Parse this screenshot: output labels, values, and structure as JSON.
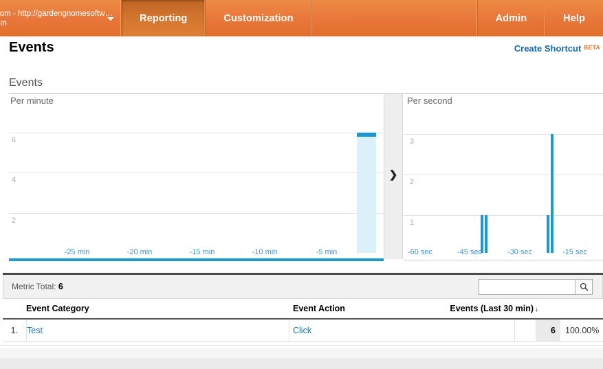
{
  "topbar": {
    "account_line1": "com - http://gardengnomesoftw…",
    "account_line2": "om",
    "tab_reporting": "Reporting",
    "tab_customization": "Customization",
    "tab_admin": "Admin",
    "tab_help": "Help",
    "accent_orange": "#e8763a",
    "active_tab": "Reporting"
  },
  "page": {
    "title": "Events",
    "create_shortcut": "Create Shortcut",
    "beta_badge": "BETA",
    "section_title": "Events"
  },
  "charts": {
    "left_label": "Per minute",
    "right_label": "Per second",
    "collapse_arrow": "❯",
    "bar_color": "#1a9ad4",
    "highlight_color": "#dcf0fa",
    "axis_label_color": "#3f96c9"
  },
  "chart_data": [
    {
      "type": "bar",
      "title": "Per minute",
      "xlabel": "",
      "ylabel": "",
      "ylim": [
        0,
        7
      ],
      "yticks": [
        2,
        4,
        6
      ],
      "grid": true,
      "x_tick_labels": [
        "-25 min",
        "-20 min",
        "-15 min",
        "-10 min",
        "-5 min"
      ],
      "x_tick_positions": [
        -25,
        -20,
        -15,
        -10,
        -5
      ],
      "x_range": [
        -30,
        0
      ],
      "highlighted_bar": {
        "x": -2,
        "value": 6
      },
      "categories": [
        -30,
        -29,
        -28,
        -27,
        -26,
        -25,
        -24,
        -23,
        -22,
        -21,
        -20,
        -19,
        -18,
        -17,
        -16,
        -15,
        -14,
        -13,
        -12,
        -11,
        -10,
        -9,
        -8,
        -7,
        -6,
        -5,
        -4,
        -3,
        -2,
        -1
      ],
      "values": [
        0,
        0,
        0,
        0,
        0,
        0,
        0,
        0,
        0,
        0,
        0,
        0,
        0,
        0,
        0,
        0,
        0,
        0,
        0,
        0,
        0,
        0,
        0,
        0,
        0,
        0,
        0,
        0,
        6,
        0
      ]
    },
    {
      "type": "bar",
      "title": "Per second",
      "xlabel": "",
      "ylabel": "",
      "ylim": [
        0,
        3.6
      ],
      "yticks": [
        1,
        2,
        3
      ],
      "grid": true,
      "x_tick_labels": [
        "-60 sec",
        "-45 sec",
        "-30 sec",
        "-15 sec"
      ],
      "x_tick_positions": [
        -60,
        -45,
        -30,
        -15
      ],
      "x_range": [
        -60,
        0
      ],
      "bars": [
        {
          "x": -44,
          "value": 1
        },
        {
          "x": -43,
          "value": 1
        },
        {
          "x": -24,
          "value": 1
        },
        {
          "x": -23,
          "value": 3
        }
      ]
    }
  ],
  "table": {
    "metric_total_label": "Metric Total:",
    "metric_total_value": "6",
    "search_placeholder": "",
    "search_value": "",
    "search_icon": "search-icon",
    "columns": [
      "Event Category",
      "Event Action",
      "Events (Last 30 min)"
    ],
    "sort_indicator": "↓",
    "rows": [
      {
        "index": "1.",
        "event_category": "Test",
        "event_action": "Click",
        "events": "6",
        "percent": "100.00%"
      }
    ]
  }
}
